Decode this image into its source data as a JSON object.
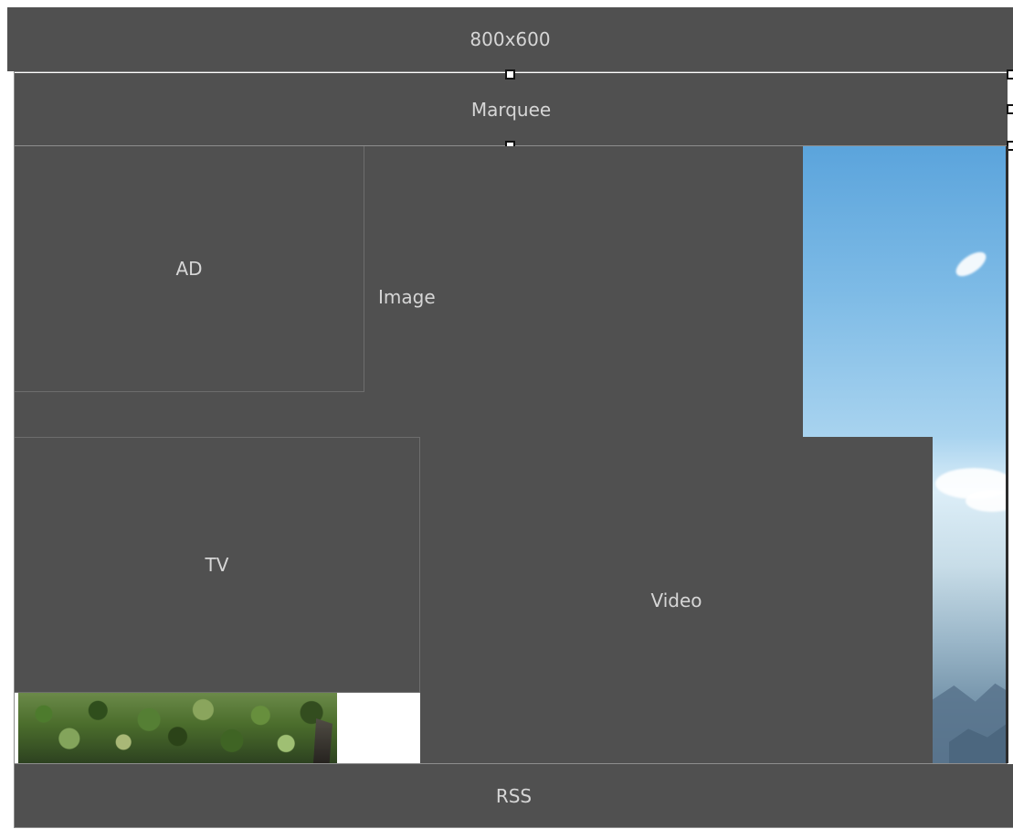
{
  "canvas": {
    "resolution_label": "800x600"
  },
  "zones": {
    "marquee": "Marquee",
    "ad": "AD",
    "image": "Image",
    "tv": "TV",
    "video": "Video",
    "rss": "RSS"
  },
  "colors": {
    "panel": "#505050",
    "text": "#d6d6d6",
    "border": "#8e8e8e",
    "handle": "#ffffff"
  }
}
